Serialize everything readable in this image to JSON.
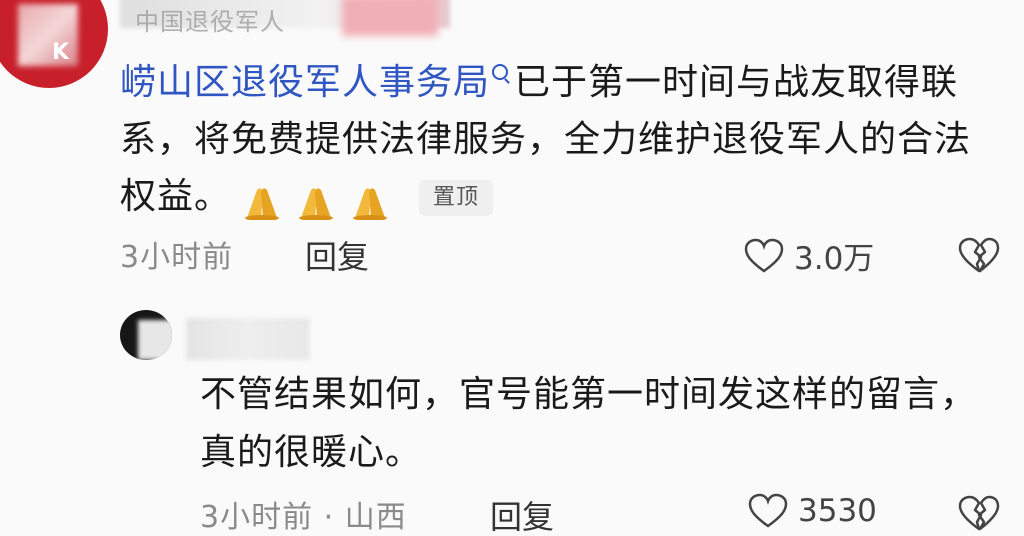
{
  "top_comment": {
    "source_text": "中国退役军人",
    "mention": "崂山区退役军人事务局",
    "text_after_mention": "已于第一时间与战友取得联系，将免费提供法律服务，全力维护退役军人的合法权益。",
    "emoji": "pray-hands-icon",
    "emoji_count": 3,
    "pinned_label": "置顶",
    "time": "3小时前",
    "reply_label": "回复",
    "likes": "3.0万"
  },
  "reply_comment": {
    "text": "不管结果如何，官号能第一时间发这样的留言，真的很暖心。",
    "time_location": "3小时前 · 山西",
    "reply_label": "回复",
    "likes": "3530"
  },
  "colors": {
    "mention": "#2f56c2",
    "avatar_red": "#c8202a",
    "meta_gray": "#8a8a8a"
  }
}
